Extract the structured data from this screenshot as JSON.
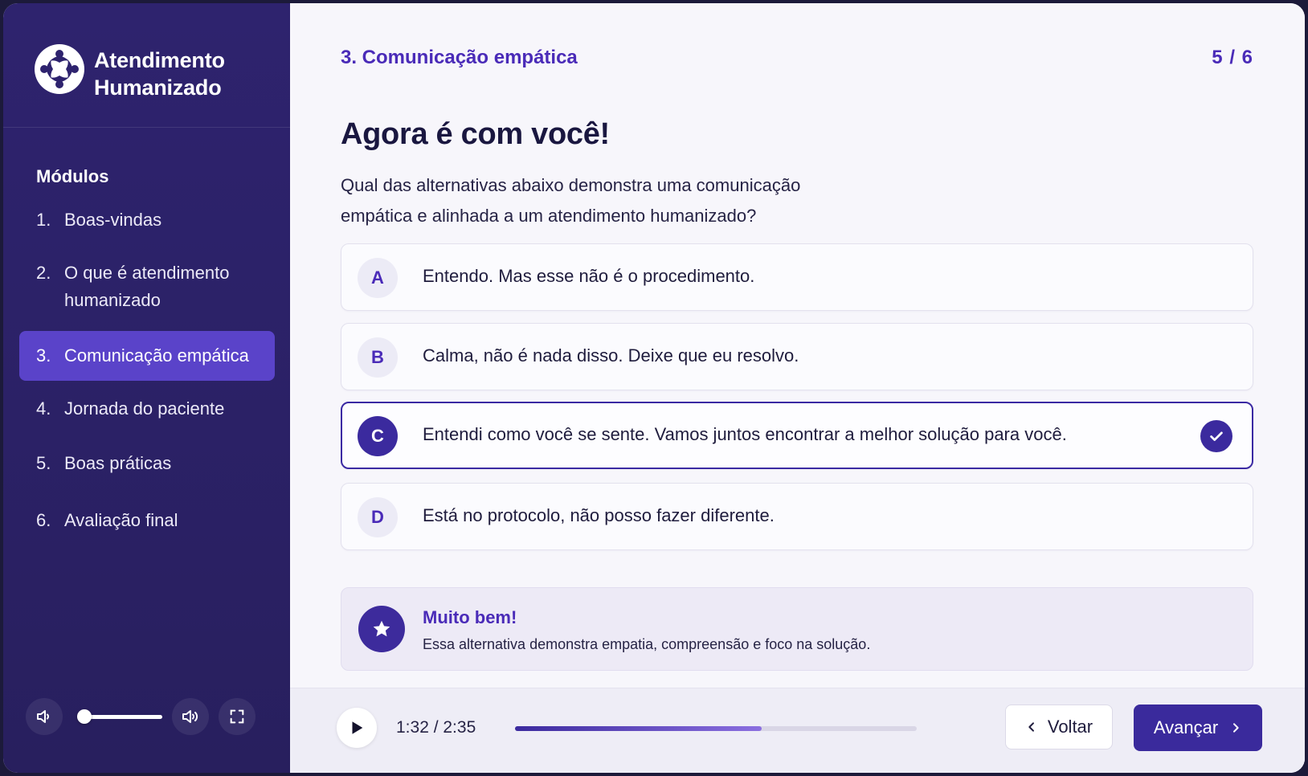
{
  "brand": {
    "line1": "Atendimento",
    "line2": "Humanizado",
    "logo_icon": "people-circle-icon"
  },
  "sidebar": {
    "title": "Módulos",
    "items": [
      {
        "num": "1.",
        "label": "Boas-vindas"
      },
      {
        "num": "2.",
        "label": "O que é atendimento humanizado"
      },
      {
        "num": "3.",
        "label": "Comunicação empática",
        "active": true
      },
      {
        "num": "4.",
        "label": "Jornada do paciente"
      },
      {
        "num": "5.",
        "label": "Boas práticas"
      },
      {
        "num": "6.",
        "label": "Avaliação final"
      }
    ],
    "controls": {
      "volume_level": 0.0,
      "icons": [
        "volume-low-icon",
        "volume-high-icon",
        "fullscreen-icon"
      ]
    }
  },
  "header": {
    "section": "3. Comunicação empática",
    "counter": "5 / 6"
  },
  "question": {
    "title": "Agora é com você!",
    "text": "Qual das alternativas abaixo demonstra uma comunicação empática e alinhada a um atendimento humanizado?"
  },
  "options": [
    {
      "letter": "A",
      "text": "Entendo. Mas esse não é o procedimento."
    },
    {
      "letter": "B",
      "text": "Calma, não é nada disso. Deixe que eu resolvo."
    },
    {
      "letter": "C",
      "text": "Entendi como você se sente. Vamos juntos encontrar a melhor solução para você.",
      "selected": true
    },
    {
      "letter": "D",
      "text": "Está no protocolo, não posso fazer diferente."
    }
  ],
  "feedback": {
    "title": "Muito bem!",
    "text": "Essa alternativa demonstra empatia, compreensão e foco na solução.",
    "icon": "star-icon"
  },
  "player": {
    "time": "1:32 / 2:35",
    "progress": 0.613
  },
  "nav": {
    "back_label": "Voltar",
    "next_label": "Avançar"
  },
  "colors": {
    "sidebar": "#2e236e",
    "accent": "#4a2bb8",
    "active_item": "#5a43c9",
    "primary_button": "#3a2a9c"
  }
}
